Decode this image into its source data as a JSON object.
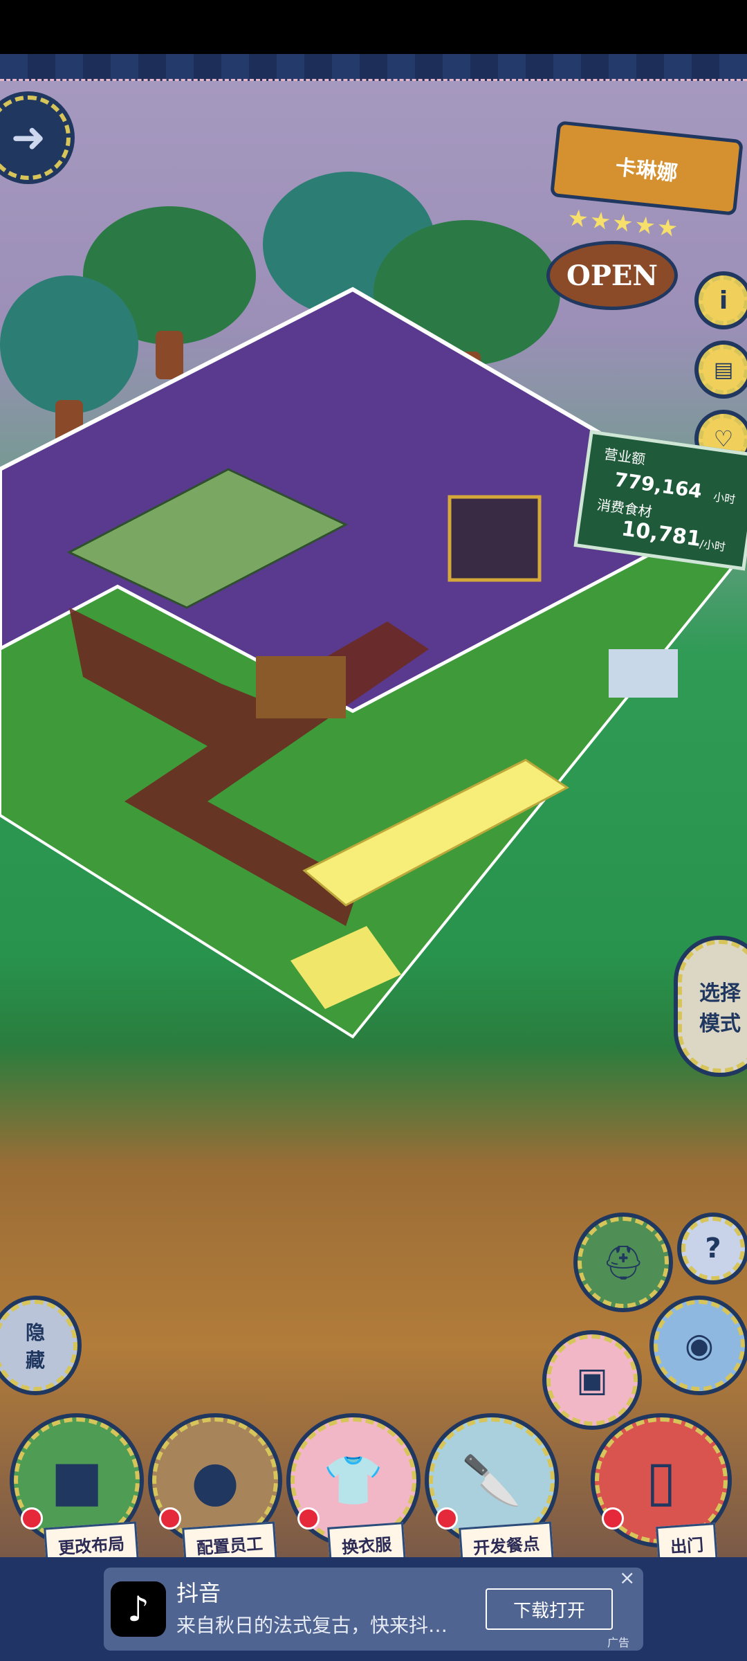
{
  "shop": {
    "name": "卡琳娜",
    "status": "OPEN",
    "rating_stars": 5
  },
  "stats": {
    "revenue_label": "营业额",
    "revenue_value": "779,164",
    "revenue_unit": "小时",
    "ingredients_label": "消费食材",
    "ingredients_value": "10,781",
    "ingredients_unit": "/小时"
  },
  "buttons": {
    "select_mode": "选择\n模式",
    "hide": "隐\n藏",
    "help": "?",
    "change_layout": "更改布局",
    "assign_staff": "配置员工",
    "change_clothes": "换衣服",
    "develop_dishes": "开发餐点",
    "exit": "出门"
  },
  "ad": {
    "app_name": "抖音",
    "description": "来自秋日的法式复古，快来抖…",
    "cta": "下载打开",
    "badge": "广告",
    "close": "×"
  },
  "colors": {
    "wall_purple": "#5a3a8f",
    "floor_green": "#3f9a3a",
    "path_brick": "#6b2a22",
    "sign_wood": "#d5902f",
    "board_green": "#1f5a3a",
    "button_frame": "#203760",
    "button_stitch": "#d7c55a"
  },
  "icons": [
    "arrow-right-icon",
    "info-icon",
    "book-icon",
    "heart-icon",
    "hat-icon",
    "help-icon",
    "camera-icon",
    "picture-icon",
    "cube-icon",
    "bear-icon",
    "shirt-icon",
    "knife-icon",
    "door-icon",
    "tiktok-icon"
  ]
}
